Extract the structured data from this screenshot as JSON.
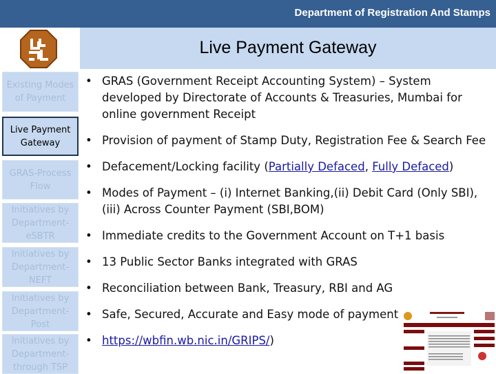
{
  "header": {
    "department": "Department of Registration And Stamps",
    "title": "Live Payment Gateway"
  },
  "colors": {
    "header_bg": "#365f92",
    "band_bg": "#c6d9f0",
    "sidebar_inactive_text": "#a7bdd8",
    "link": "#1a1aa6",
    "logo_brown": "#b5651d"
  },
  "sidebar": {
    "items": [
      {
        "label": "Existing Modes of Payment",
        "active": false
      },
      {
        "label": "Live Payment Gateway",
        "active": true
      },
      {
        "label": "GRAS-Process Flow",
        "active": false
      },
      {
        "label": "Initiatives by Department-eSBTR",
        "active": false
      },
      {
        "label": "Initiatives by Department-NEFT",
        "active": false
      },
      {
        "label": "Initiatives by Department-Post",
        "active": false
      },
      {
        "label": "Initiatives by Department-through TSP",
        "active": false
      }
    ]
  },
  "bullets": {
    "b1": "GRAS (Government Receipt Accounting System) – System developed by Directorate of Accounts & Treasuries, Mumbai for online government Receipt",
    "b2": "Provision of payment of Stamp Duty, Registration Fee & Search Fee",
    "b3_pre": "Defacement/Locking facility (",
    "b3_link1": "Partially Defaced",
    "b3_sep": ", ",
    "b3_link2": "Fully Defaced",
    "b3_post": ")",
    "b4": "Modes of Payment – (i) Internet Banking,(ii) Debit Card (Only SBI),(iii) Across Counter Payment (SBI,BOM)",
    "b5": "Immediate credits to the Government Account on T+1 basis",
    "b6": "13 Public Sector Banks integrated with GRAS",
    "b7": "Reconciliation between Bank, Treasury, RBI and AG",
    "b8": "Safe, Secured, Accurate and Easy mode of payment",
    "b9_link": "https://wbfin.wb.nic.in/GRIPS/",
    "b9_post": ")"
  },
  "bullet_glyph": "•"
}
